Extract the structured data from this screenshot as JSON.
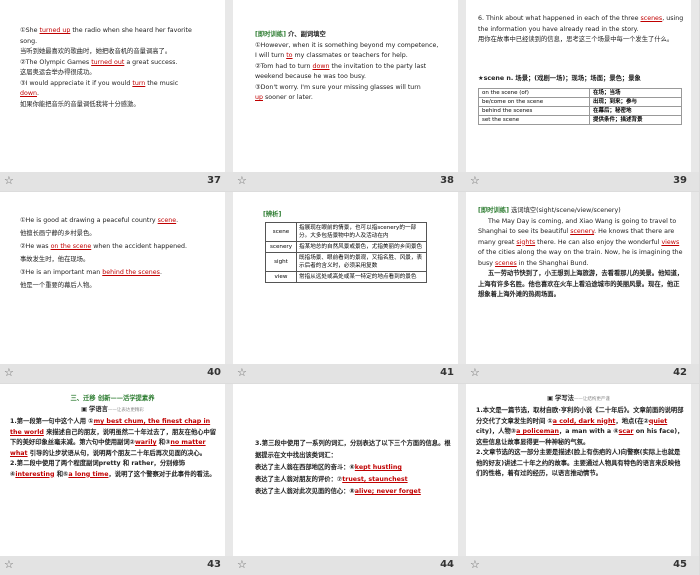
{
  "slides": [
    {
      "num": "37",
      "lines": [
        {
          "marker": "①",
          "pre": "She ",
          "hl": "turned up",
          "post": " the radio when she heard her favorite"
        },
        {
          "pre": "song."
        },
        {
          "pre": "当听到她最喜欢的歌曲时，她把收音机的音量调高了。"
        },
        {
          "marker": "②",
          "pre": "The Olympic Games ",
          "hl": "turned out",
          "post": " a great success."
        },
        {
          "pre": "这届奥运会举办得很成功。"
        },
        {
          "marker": "③",
          "pre": "I would appreciate it if you would ",
          "hl": "turn",
          "post": " the music"
        },
        {
          "hl": "down",
          "post": "."
        },
        {
          "pre": "如果你能把音乐的音量调低我将十分感激。"
        }
      ]
    },
    {
      "num": "38",
      "heading_tag": "[即时训练]",
      "heading": "介、副词填空",
      "lines": [
        {
          "marker": "①",
          "pre": "However, when it is something beyond my competence,"
        },
        {
          "pre": "I will turn ",
          "hl": "to",
          "post": " my classmates or teachers for help."
        },
        {
          "marker": "②",
          "pre": "Tom had to turn ",
          "hl": "down",
          "post": " the invitation to the party last"
        },
        {
          "pre": "weekend because he was too busy."
        },
        {
          "marker": "③",
          "pre": "Don't worry. I'm sure your missing glasses will turn"
        },
        {
          "hl": "up",
          "post": " sooner or later."
        }
      ]
    },
    {
      "num": "39",
      "q": "6. Think about what happened in each of the three ",
      "q_hl": "scenes",
      "q_post": ", using the information you have already read in the story.",
      "q_cn": "用你在故事中已经读到的信息，思考这三个场景中每一个发生了什么。",
      "label": "★scene n. 场景；(戏剧一场)；现场；场面；景色；景象",
      "rows": [
        [
          "on the scene (of)",
          "在场；当场"
        ],
        [
          "be/come on the scene",
          "出现；到来；参与"
        ],
        [
          "behind the scenes",
          "在幕后；秘密地"
        ],
        [
          "set the scene",
          "提供条件；描述背景"
        ]
      ]
    },
    {
      "num": "40",
      "lines": [
        {
          "marker": "①",
          "pre": "He is good at drawing a peaceful country ",
          "hl": "scene",
          "post": "."
        },
        {
          "pre": "他擅长画宁静的乡村景色。"
        },
        {
          "marker": "②",
          "pre": "He was ",
          "hl": "on the scene",
          "post": " when the accident happened."
        },
        {
          "pre": "事故发生时，他在现场。"
        },
        {
          "marker": "③",
          "pre": "He is an important man ",
          "hl": "behind the scenes",
          "post": "."
        },
        {
          "pre": "他是一个重要的幕后人物。"
        }
      ]
    },
    {
      "num": "41",
      "tag": "[辨析]",
      "rows": [
        [
          "scene",
          "指展现在眼前的情景，也可以指scenery的一部分。大多包括景物中的人及活动在内"
        ],
        [
          "scenery",
          "指某地总的自然风景或景色，尤指美丽的乡间景色"
        ],
        [
          "sight",
          "既指场景、眼前看到的景观，又指名胜、风景，表示后者的含义时，必须采用复数"
        ],
        [
          "view",
          "常指从远处或高处或某一特定的地点看到的景色"
        ]
      ]
    },
    {
      "num": "42",
      "tag": "[即时训练]",
      "heading": "选词填空(sight/scene/view/scenery)",
      "lines": [
        {
          "pre": "The May Day is coming, and Xiao Wang is going to travel to"
        },
        {
          "pre": "Shanghai to see its beautiful ",
          "hl": "scenery",
          ".": "",
          "post": ". He knows that there are"
        },
        {
          "pre": "many great ",
          "hl": "sights",
          "post": " there. He can also enjoy the wonderful ",
          "hl2": "views"
        },
        {
          "pre": "of the cities along the way on the train. Now, he is imagining the"
        },
        {
          "pre": "busy ",
          "hl": "scenes",
          "post": " in the Shanghai Bund."
        }
      ],
      "cn": "五一劳动节快到了，小王想到上海旅游，去看看那儿的美景。他知道，上海有许多名胜。他也喜欢在火车上看沿途城市的美丽风景。现在，他正想象着上海外滩的热闹场面。"
    },
    {
      "num": "43",
      "section": "三、迁移 创新——活学提素养",
      "sub": "学语言",
      "sub2": "——让表达更精彩",
      "items": [
        {
          "n": "1.",
          "t1": "第一段第一句中这个人用 ①",
          "hl": "my best chum, the finest chap in the world",
          "t2": " 来描述自己的朋友，说明虽然二十年过去了，朋友在他心中留下的美好印象丝毫未减。第六句中使用副词②",
          "hl2": "warily",
          "t3": " 和③",
          "hl3": "no matter what",
          "t4": " 引导的让步状语从句，说明两个朋友二十年后再次见面的决心。"
        },
        {
          "n": "2.",
          "t1": "第二段中使用了两个程度副词pretty 和 rather，分别修饰④",
          "hl": "interesting",
          "t2": " 和⑤",
          "hl2": "a long time",
          "t3": "，说明了这个警察对于此事件的看法。"
        }
      ]
    },
    {
      "num": "44",
      "items": [
        {
          "n": "3.",
          "t1": "第三段中使用了一系列的词汇，分别表达了以下三个方面的信息。根据提示在文中找出该类词汇："
        },
        {
          "t1": "表达了主人翁在西部地区的奋斗：⑥",
          "hl": "kept hustling"
        },
        {
          "t1": "表达了主人翁对朋友的评价：⑦",
          "hl": "truest, staunchest"
        },
        {
          "t1": "表达了主人翁对此次见面的信心：⑧",
          "hl": "alive; never forget"
        }
      ]
    },
    {
      "num": "45",
      "sub": "学写法",
      "sub2": "——让结构更严谨",
      "items": [
        {
          "n": "1.",
          "t1": "本文是一篇节选，取材自欧·亨利的小说《二十年后》。文章前面的说明部分交代了文章发生的时间 ①",
          "hl": "a cold, dark night",
          "t2": "，地点(在②",
          "hl2": "quiet",
          "t3": " city)，人物③",
          "hl3": "a policeman",
          "t4": "，a man with a ④",
          "hl4": "scar",
          "t5": " on his face)，这些信息让故事显得更一种神秘的气氛。"
        },
        {
          "n": "2.",
          "t1": "文章节选的这一部分主要是描述(脸上有伤疤的人)向警察(实际上也就是他的好友)讲述二十年之约的故事。主要通过人物具有特色的语言来反映他们的性格，着有过的经历，以语言推动情节。"
        }
      ]
    }
  ]
}
